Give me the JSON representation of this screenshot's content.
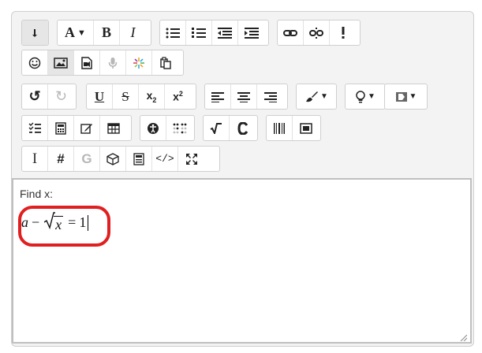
{
  "toolbar": {
    "text_heading_label": "A",
    "bold_label": "B",
    "italic_label": "I",
    "undo_label": "↺",
    "redo_label": "↻",
    "underline_label": "U",
    "strike_label": "S",
    "subscript_base": "x",
    "subscript_suffix": "2",
    "superscript_base": "x",
    "superscript_suffix": "2",
    "special_char_label": "#",
    "g_label": "G",
    "cursor_label": "I",
    "code_label": "</>"
  },
  "editor": {
    "label": "Find x:",
    "formula": {
      "a": "a",
      "minus": "−",
      "x": "x",
      "equals": "=",
      "one": "1"
    }
  }
}
